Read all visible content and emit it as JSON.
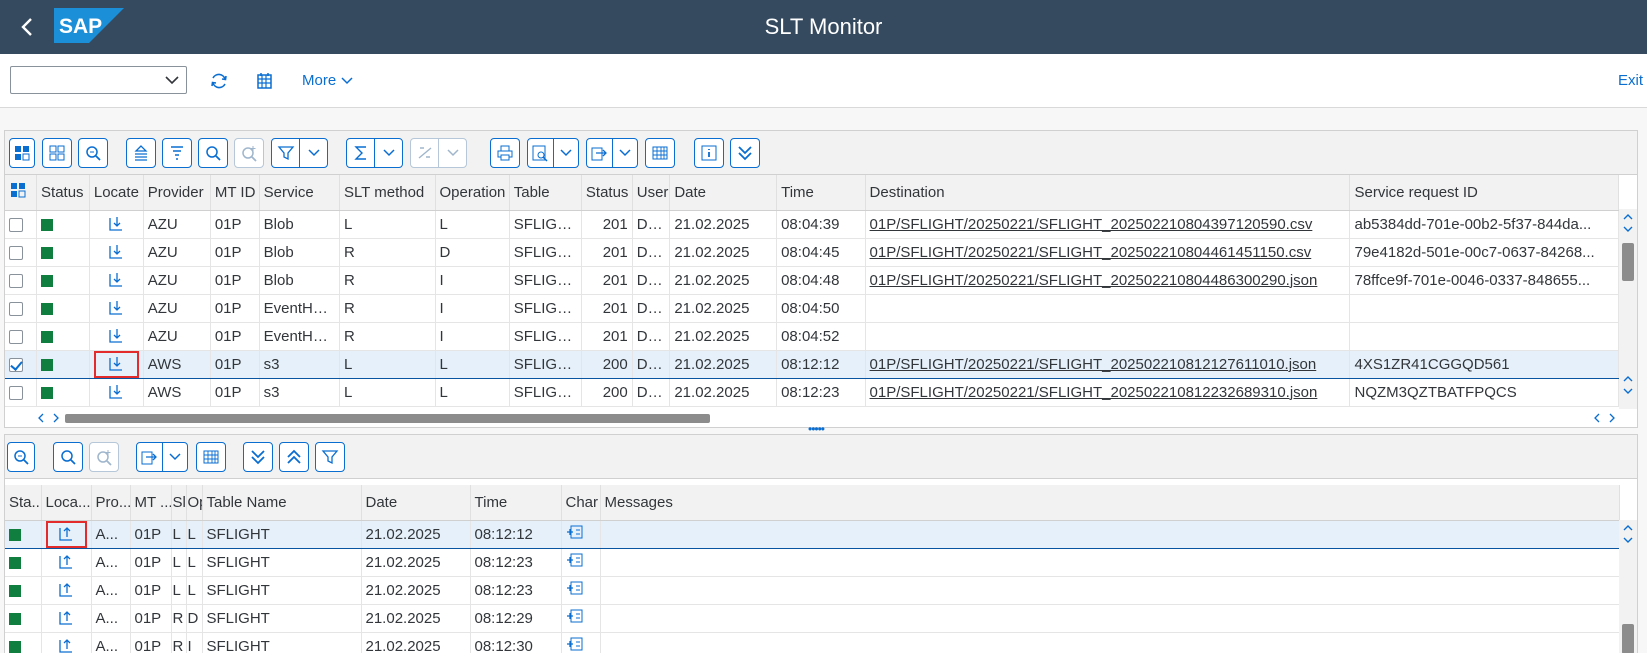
{
  "shell": {
    "title": "SLT Monitor",
    "logo_text": "SAP"
  },
  "toolbar": {
    "okcode_value": "",
    "more_label": "More",
    "exit_label": "Exit"
  },
  "upper": {
    "columns": [
      "Status",
      "Locate",
      "Provider",
      "MT ID",
      "Service",
      "SLT method",
      "Operation",
      "Table",
      "Status",
      "User",
      "Date",
      "Time",
      "Destination",
      "Service request ID"
    ],
    "rows": [
      {
        "checked": false,
        "provider": "AZU",
        "mtid": "01P",
        "service": "Blob",
        "method": "L",
        "operation": "L",
        "table": "SFLIGHT",
        "status_code": "201",
        "user": "DDIC",
        "date": "21.02.2025",
        "time": "08:04:39",
        "destination": "01P/SFLIGHT/20250221/SFLIGHT_20250221080439712059​0.csv",
        "request_id": "ab5384dd-701e-00b2-5f37-844da..."
      },
      {
        "checked": false,
        "provider": "AZU",
        "mtid": "01P",
        "service": "Blob",
        "method": "R",
        "operation": "D",
        "table": "SFLIGHT",
        "status_code": "201",
        "user": "DDIC",
        "date": "21.02.2025",
        "time": "08:04:45",
        "destination": "01P/SFLIGHT/20250221/SFLIGHT_20250221080446145115​0.csv",
        "request_id": "79e4182d-501e-00c7-0637-84268..."
      },
      {
        "checked": false,
        "provider": "AZU",
        "mtid": "01P",
        "service": "Blob",
        "method": "R",
        "operation": "I",
        "table": "SFLIGHT",
        "status_code": "201",
        "user": "DDIC",
        "date": "21.02.2025",
        "time": "08:04:48",
        "destination": "01P/SFLIGHT/20250221/SFLIGHT_20250221080448630029​0.json",
        "request_id": "78ffce9f-701e-0046-0337-848655..."
      },
      {
        "checked": false,
        "provider": "AZU",
        "mtid": "01P",
        "service": "EventHubs",
        "method": "R",
        "operation": "I",
        "table": "SFLIGHT",
        "status_code": "201",
        "user": "DDIC",
        "date": "21.02.2025",
        "time": "08:04:50",
        "destination": "",
        "request_id": ""
      },
      {
        "checked": false,
        "provider": "AZU",
        "mtid": "01P",
        "service": "EventHubs",
        "method": "R",
        "operation": "I",
        "table": "SFLIGHT",
        "status_code": "201",
        "user": "DDIC",
        "date": "21.02.2025",
        "time": "08:04:52",
        "destination": "",
        "request_id": ""
      },
      {
        "checked": true,
        "provider": "AWS",
        "mtid": "01P",
        "service": "s3",
        "method": "L",
        "operation": "L",
        "table": "SFLIGHT",
        "status_code": "200",
        "user": "DDIC",
        "date": "21.02.2025",
        "time": "08:12:12",
        "destination": "01P/SFLIGHT/20250221/SFLIGHT_20250221081212761101​0.json",
        "request_id": "4XS1ZR41CGGQD561"
      },
      {
        "checked": false,
        "provider": "AWS",
        "mtid": "01P",
        "service": "s3",
        "method": "L",
        "operation": "L",
        "table": "SFLIGHT",
        "status_code": "200",
        "user": "DDIC",
        "date": "21.02.2025",
        "time": "08:12:23",
        "destination": "01P/SFLIGHT/20250221/SFLIGHT_20250221081223268931​0.json",
        "request_id": "NQZM3QZTBATFPQCS"
      }
    ]
  },
  "lower": {
    "columns": [
      "Sta...",
      "Loca...",
      "Pro...",
      "MT ...",
      "Sl",
      "Op",
      "Table Name",
      "Date",
      "Time",
      "Char",
      "Messages"
    ],
    "rows": [
      {
        "provider": "A...",
        "mtid": "01P",
        "sl": "L",
        "op": "L",
        "table": "SFLIGHT",
        "date": "21.02.2025",
        "time": "08:12:12"
      },
      {
        "provider": "A...",
        "mtid": "01P",
        "sl": "L",
        "op": "L",
        "table": "SFLIGHT",
        "date": "21.02.2025",
        "time": "08:12:23"
      },
      {
        "provider": "A...",
        "mtid": "01P",
        "sl": "L",
        "op": "L",
        "table": "SFLIGHT",
        "date": "21.02.2025",
        "time": "08:12:23"
      },
      {
        "provider": "A...",
        "mtid": "01P",
        "sl": "R",
        "op": "D",
        "table": "SFLIGHT",
        "date": "21.02.2025",
        "time": "08:12:29"
      },
      {
        "provider": "A...",
        "mtid": "01P",
        "sl": "R",
        "op": "I",
        "table": "SFLIGHT",
        "date": "21.02.2025",
        "time": "08:12:30"
      }
    ]
  },
  "colors": {
    "shell": "#354a5f",
    "accent": "#0a6ed1",
    "status_green": "#107e3e",
    "highlight": "#e32b2b"
  },
  "icons": [
    "back-arrow-icon",
    "refresh-icon",
    "calendar-grid-icon",
    "chevron-down-icon",
    "locate-down-icon",
    "locate-up-icon",
    "message-add-icon"
  ]
}
